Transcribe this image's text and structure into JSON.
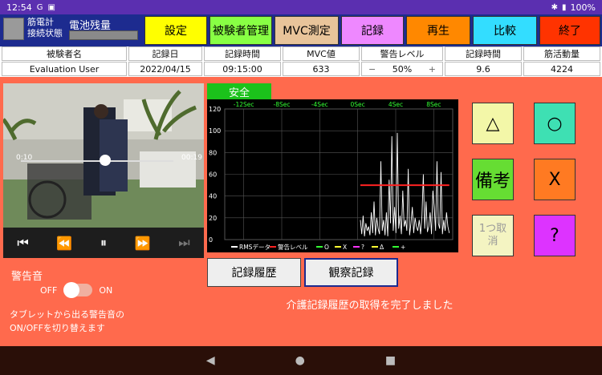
{
  "status_bar": {
    "time": "12:54",
    "left_icons": [
      "G",
      "▣"
    ],
    "battery": "100%"
  },
  "topbar": {
    "sensor_status": [
      "筋電計",
      "接続状態"
    ],
    "battery_label": "電池残量",
    "buttons": [
      {
        "label": "設定",
        "color": "#ffff00"
      },
      {
        "label": "被験者管理",
        "color": "#88ff44"
      },
      {
        "label": "MVC測定",
        "color": "#e8c49a"
      },
      {
        "label": "記録",
        "color": "#ee88ff"
      },
      {
        "label": "再生",
        "color": "#ff8800"
      },
      {
        "label": "比較",
        "color": "#33ddff"
      },
      {
        "label": "終了",
        "color": "#ff3300"
      }
    ]
  },
  "info_table": {
    "headers": [
      "被験者名",
      "記録日",
      "記録時間",
      "MVC値",
      "警告レベル",
      "記録時間",
      "筋活動量"
    ],
    "values": [
      "Evaluation User",
      "2022/04/15",
      "09:15:00",
      "633",
      "50%",
      "9.6",
      "4224"
    ],
    "warn_minus": "−",
    "warn_plus": "+"
  },
  "video": {
    "time_left": "0:10",
    "time_right": "00:19",
    "progress": 0.55
  },
  "safe_label": "安全",
  "chart_data": {
    "type": "line",
    "x_ticks": [
      "-12Sec",
      "-8Sec",
      "-4Sec",
      "0Sec",
      "4Sec",
      "8Sec"
    ],
    "y_ticks": [
      0,
      20,
      40,
      60,
      80,
      100,
      120
    ],
    "ylim": [
      0,
      120
    ],
    "grid": true,
    "legend_position": "bottom",
    "legend": [
      "RMSデータ",
      "警告レベル",
      "O",
      "X",
      "?",
      "Δ",
      "+"
    ],
    "series": [
      {
        "name": "RMSデータ",
        "values": [
          18,
          5,
          22,
          3,
          15,
          8,
          12,
          4,
          25,
          6,
          35,
          4,
          20,
          10,
          5,
          72,
          8,
          18,
          4,
          25,
          3,
          55,
          15,
          95,
          8,
          30,
          6,
          98,
          10,
          22,
          5,
          45,
          12,
          18,
          8,
          65,
          4,
          15,
          30,
          6,
          20,
          12,
          8,
          18,
          5,
          22,
          60,
          10,
          35,
          7,
          12,
          25,
          5,
          45,
          30,
          8,
          72,
          15,
          10,
          62,
          5,
          18,
          8,
          25,
          12,
          6
        ]
      },
      {
        "name": "警告レベル",
        "value": 50
      }
    ]
  },
  "side_buttons": [
    {
      "label": "△",
      "color": "#f3f7a8"
    },
    {
      "label": "○",
      "color": "#3ee0b3"
    },
    {
      "label": "備考",
      "color": "#66dd33"
    },
    {
      "label": "X",
      "color": "#ff7a22"
    },
    {
      "label": "1つ取消",
      "color": "#f4f4c2"
    },
    {
      "label": "?",
      "color": "#dd33ff"
    }
  ],
  "history_buttons": [
    "記録履歴",
    "観察記録"
  ],
  "alarm": {
    "title": "警告音",
    "off": "OFF",
    "on": "ON",
    "description": "タブレットから出る警告音のON/OFFを切り替えます"
  },
  "message": "介護記録履歴の取得を完了しました",
  "nav": [
    "◀",
    "●",
    "■"
  ]
}
